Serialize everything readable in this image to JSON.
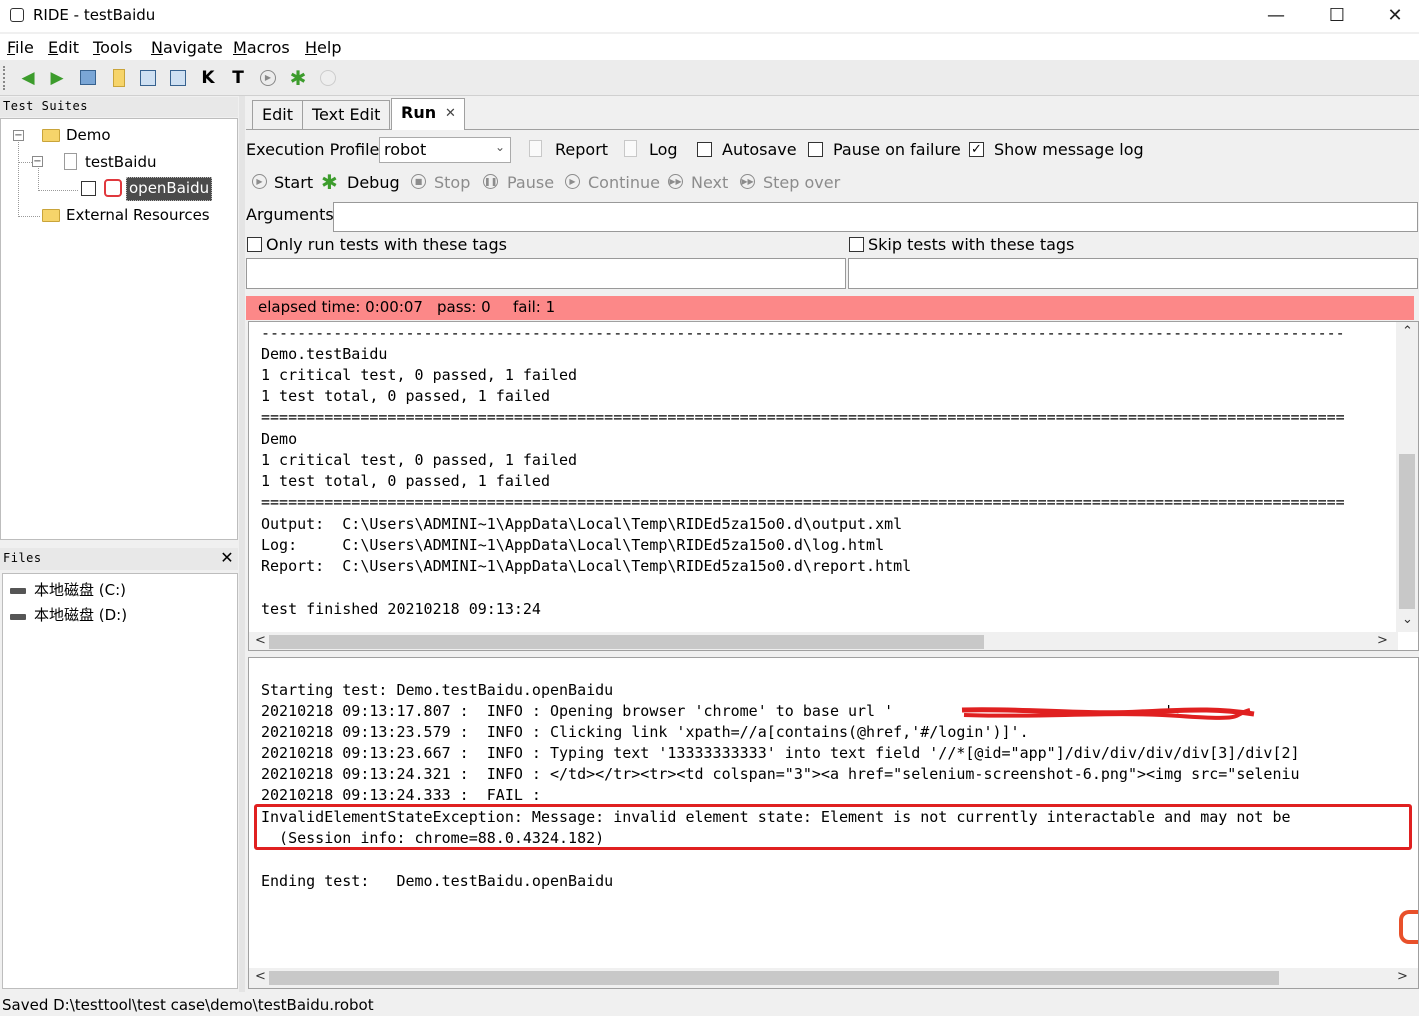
{
  "window": {
    "title": "RIDE - testBaidu",
    "minimize": "—",
    "maximize": "☐",
    "close": "✕"
  },
  "menu": [
    {
      "key": "F",
      "rest": "ile"
    },
    {
      "key": "E",
      "rest": "dit"
    },
    {
      "key": "T",
      "rest": "ools"
    },
    {
      "key": "N",
      "rest": "avigate"
    },
    {
      "key": "M",
      "rest": "acros"
    },
    {
      "key": "H",
      "rest": "elp"
    }
  ],
  "toolbar": {
    "k_icon": "K",
    "t_icon": "T"
  },
  "suites": {
    "header": "Test Suites",
    "items": [
      "Demo",
      "testBaidu",
      "openBaidu",
      "External Resources"
    ]
  },
  "files": {
    "header": "Files",
    "close": "✕",
    "drives": [
      "本地磁盘 (C:)",
      "本地磁盘 (D:)"
    ]
  },
  "tabs": [
    "Edit",
    "Text Edit",
    "Run"
  ],
  "tab_close": "✕",
  "run": {
    "profile_label": "Execution Profile:",
    "profile_value": "robot",
    "report": "Report",
    "log": "Log",
    "autosave": "Autosave",
    "pause_on_failure": "Pause on failure",
    "show_message_log": "Show message log",
    "show_message_log_checked": "✓",
    "start": "Start",
    "debug": "Debug",
    "stop": "Stop",
    "pause": "Pause",
    "continue": "Continue",
    "next": "Next",
    "step_over": "Step over",
    "arguments_label": "Arguments:",
    "only_run_tags": "Only run tests with these tags",
    "skip_tags": "Skip tests with these tags"
  },
  "status": {
    "elapsed": "elapsed time: 0:00:07",
    "pass": "pass: 0",
    "fail": "fail: 1",
    "color": "#fc8888"
  },
  "console1": [
    "------------------------------------------------------------------------------------------------------------------------",
    "Demo.testBaidu",
    "1 critical test, 0 passed, 1 failed",
    "1 test total, 0 passed, 1 failed",
    "========================================================================================================================",
    "Demo",
    "1 critical test, 0 passed, 1 failed",
    "1 test total, 0 passed, 1 failed",
    "========================================================================================================================",
    "Output:  C:\\Users\\ADMINI~1\\AppData\\Local\\Temp\\RIDEd5za15o0.d\\output.xml",
    "Log:     C:\\Users\\ADMINI~1\\AppData\\Local\\Temp\\RIDEd5za15o0.d\\log.html",
    "Report:  C:\\Users\\ADMINI~1\\AppData\\Local\\Temp\\RIDEd5za15o0.d\\report.html",
    "",
    "test finished 20210218 09:13:24"
  ],
  "console2": [
    "Starting test: Demo.testBaidu.openBaidu",
    "20210218 09:13:17.807 :  INFO : Opening browser 'chrome' to base url '                              '.",
    "20210218 09:13:23.579 :  INFO : Clicking link 'xpath=//a[contains(@href,'#/login')]'.",
    "20210218 09:13:23.667 :  INFO : Typing text '13333333333' into text field '//*[@id=\"app\"]/div/div/div/div[3]/div[2]",
    "20210218 09:13:24.321 :  INFO : </td></tr><tr><td colspan=\"3\"><a href=\"selenium-screenshot-6.png\"><img src=\"seleniu",
    "20210218 09:13:24.333 :  FAIL :",
    "InvalidElementStateException: Message: invalid element state: Element is not currently interactable and may not be",
    "  (Session info: chrome=88.0.4324.182)",
    "",
    "Ending test:   Demo.testBaidu.openBaidu"
  ],
  "statusbar": "Saved D:\\testtool\\test case\\demo\\testBaidu.robot",
  "colors": {
    "highlight_box": "#e02020",
    "fail_strip": "#fc8888"
  }
}
